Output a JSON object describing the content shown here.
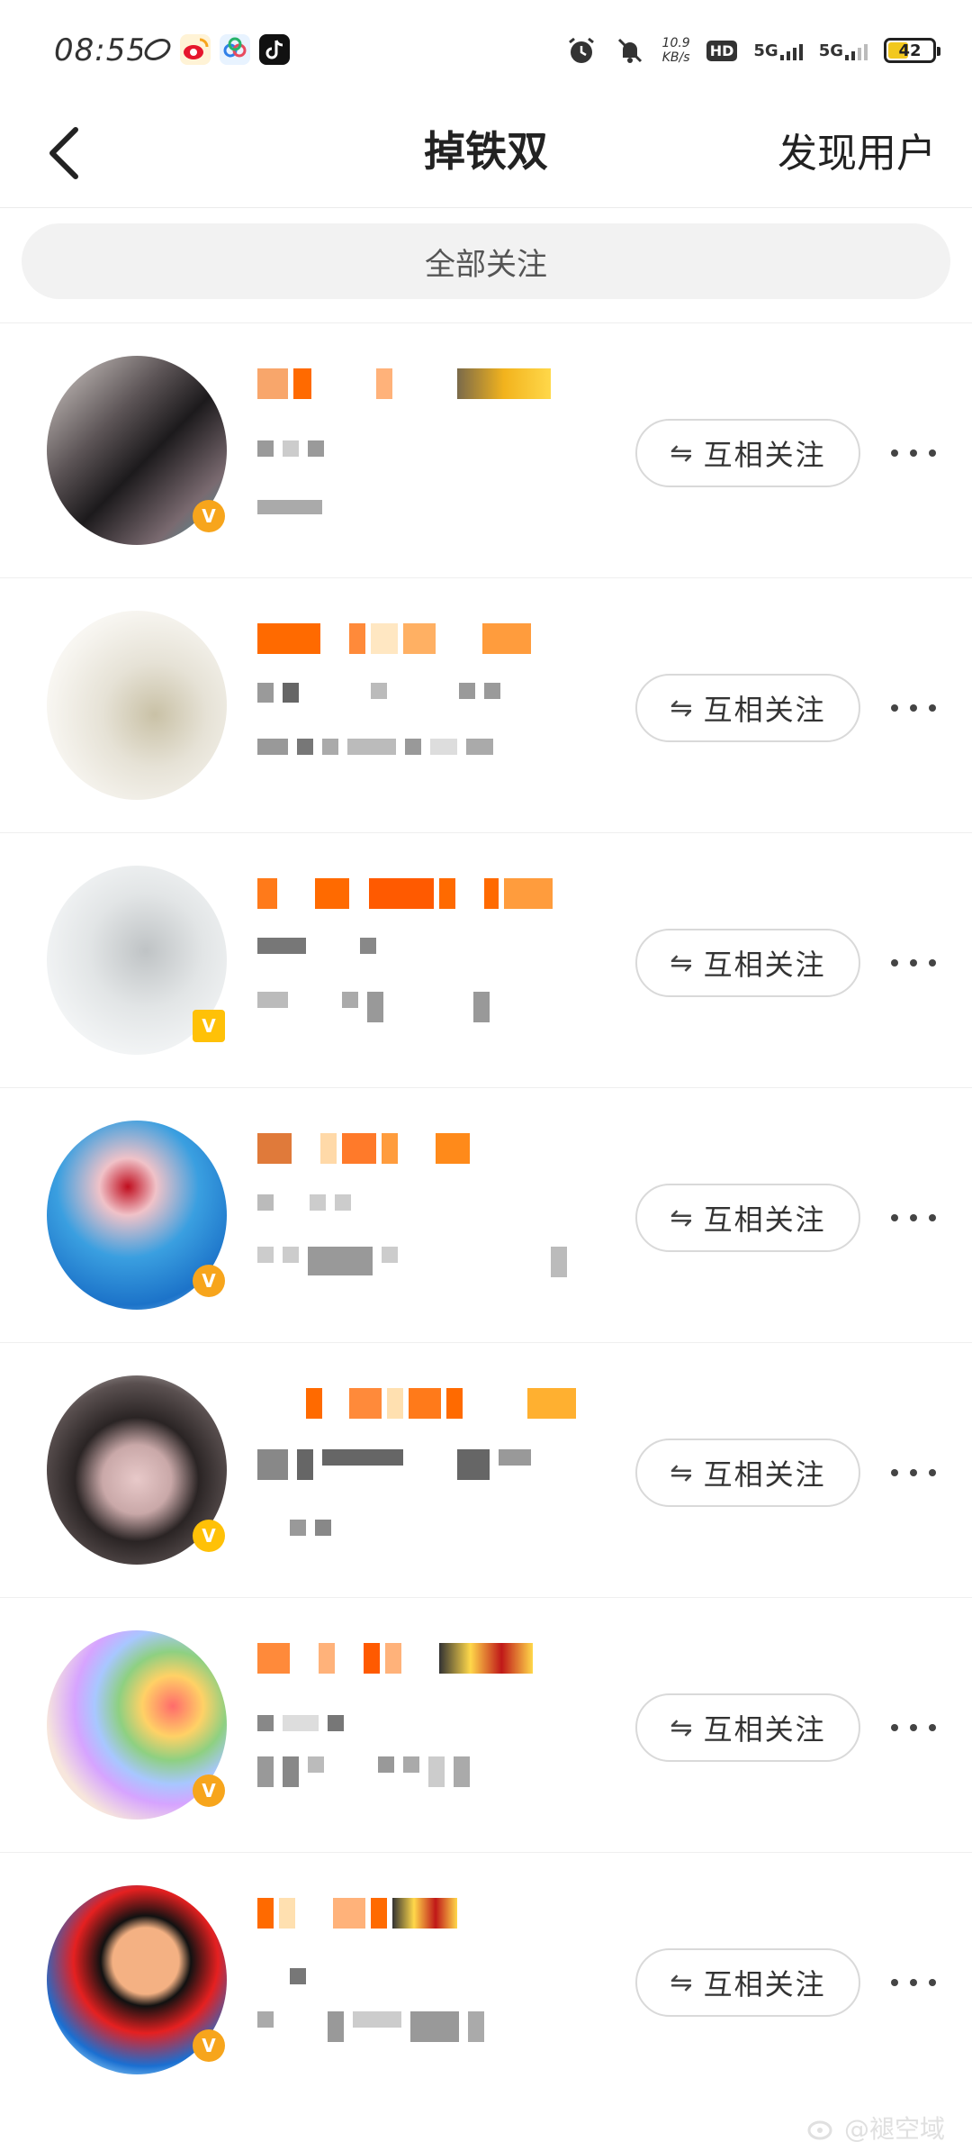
{
  "status": {
    "time": "08:55",
    "net_speed_value": "10.9",
    "net_speed_unit": "KB/s",
    "hd_label": "HD",
    "sim1": "5G",
    "sim2": "5G",
    "battery": "42",
    "battery_level": 0.42
  },
  "header": {
    "title": "掉铁双",
    "discover_label": "发现用户",
    "back_icon": "chevron-left-icon"
  },
  "search": {
    "placeholder": "全部关注"
  },
  "list": {
    "rows": [
      {
        "follow_label": "互相关注",
        "follow_icon": "⇋"
      },
      {
        "follow_label": "互相关注",
        "follow_icon": "⇋"
      },
      {
        "follow_label": "互相关注",
        "follow_icon": "⇋"
      },
      {
        "follow_label": "互相关注",
        "follow_icon": "⇋"
      },
      {
        "follow_label": "互相关注",
        "follow_icon": "⇋"
      },
      {
        "follow_label": "互相关注",
        "follow_icon": "⇋"
      },
      {
        "follow_label": "互相关注",
        "follow_icon": "⇋"
      }
    ]
  },
  "watermark": {
    "text": "@褪空域"
  },
  "colors": {
    "accent_orange": "#ff6a00",
    "badge_yellow": "#f7a51c",
    "battery_yellow": "#f2c81e"
  }
}
